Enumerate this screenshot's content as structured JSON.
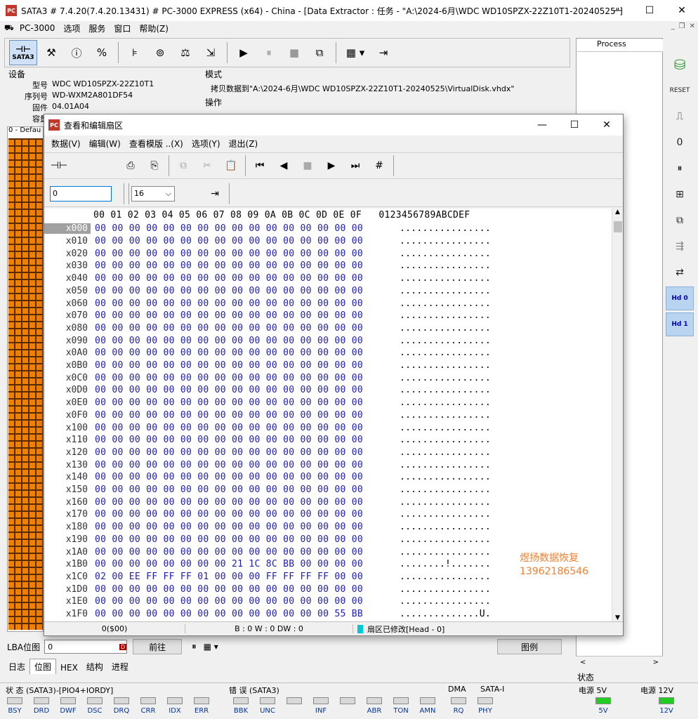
{
  "app": {
    "title": "SATA3 # 7.4.20(7.4.20.13431) # PC-3000 EXPRESS (x64) - China - [Data Extractor : 任务 - \"A:\\2024-6月\\WDC WD10SPZX-22Z10T1-20240525\"]",
    "icon_text": "PC",
    "menu": [
      "PC-3000",
      "选项",
      "服务",
      "窗口",
      "帮助(Z)"
    ],
    "toolbar": {
      "sata3_label": "SATA3"
    }
  },
  "device": {
    "section_label": "设备",
    "fields": [
      {
        "k": "型号",
        "v": "WDC WD10SPZX-22Z10T1"
      },
      {
        "k": "序列号",
        "v": "WD-WXM2A801DF54"
      },
      {
        "k": "固件",
        "v": "04.01A04"
      },
      {
        "k": "容量",
        "v": ""
      }
    ]
  },
  "mode": {
    "label": "模式",
    "text": "拷贝数据到\"A:\\2024-6月\\WDC WD10SPZX-22Z10T1-20240525\\VirtualDisk.vhdx\"",
    "op_label": "操作"
  },
  "left_tab": "0 - Defau",
  "process_label": "Process",
  "dialog": {
    "title": "查看和编辑扇区",
    "menu": [
      "数据(V)",
      "编辑(W)",
      "查看模版 ..(X)",
      "选项(Y)",
      "退出(Z)"
    ],
    "sector_value": "0",
    "size_value": "16",
    "header": "00 01 02 03 04 05 06 07 08 09 0A 0B 0C 0D 0E 0F   0123456789ABCDEF",
    "rows": [
      {
        "off": "x000",
        "bytes": "00 00 00 00 00 00 00 00 00 00 00 00 00 00 00 00",
        "ascii": "................"
      },
      {
        "off": "x010",
        "bytes": "00 00 00 00 00 00 00 00 00 00 00 00 00 00 00 00",
        "ascii": "................"
      },
      {
        "off": "x020",
        "bytes": "00 00 00 00 00 00 00 00 00 00 00 00 00 00 00 00",
        "ascii": "................"
      },
      {
        "off": "x030",
        "bytes": "00 00 00 00 00 00 00 00 00 00 00 00 00 00 00 00",
        "ascii": "................"
      },
      {
        "off": "x040",
        "bytes": "00 00 00 00 00 00 00 00 00 00 00 00 00 00 00 00",
        "ascii": "................"
      },
      {
        "off": "x050",
        "bytes": "00 00 00 00 00 00 00 00 00 00 00 00 00 00 00 00",
        "ascii": "................"
      },
      {
        "off": "x060",
        "bytes": "00 00 00 00 00 00 00 00 00 00 00 00 00 00 00 00",
        "ascii": "................"
      },
      {
        "off": "x070",
        "bytes": "00 00 00 00 00 00 00 00 00 00 00 00 00 00 00 00",
        "ascii": "................"
      },
      {
        "off": "x080",
        "bytes": "00 00 00 00 00 00 00 00 00 00 00 00 00 00 00 00",
        "ascii": "................"
      },
      {
        "off": "x090",
        "bytes": "00 00 00 00 00 00 00 00 00 00 00 00 00 00 00 00",
        "ascii": "................"
      },
      {
        "off": "x0A0",
        "bytes": "00 00 00 00 00 00 00 00 00 00 00 00 00 00 00 00",
        "ascii": "................"
      },
      {
        "off": "x0B0",
        "bytes": "00 00 00 00 00 00 00 00 00 00 00 00 00 00 00 00",
        "ascii": "................"
      },
      {
        "off": "x0C0",
        "bytes": "00 00 00 00 00 00 00 00 00 00 00 00 00 00 00 00",
        "ascii": "................"
      },
      {
        "off": "x0D0",
        "bytes": "00 00 00 00 00 00 00 00 00 00 00 00 00 00 00 00",
        "ascii": "................"
      },
      {
        "off": "x0E0",
        "bytes": "00 00 00 00 00 00 00 00 00 00 00 00 00 00 00 00",
        "ascii": "................"
      },
      {
        "off": "x0F0",
        "bytes": "00 00 00 00 00 00 00 00 00 00 00 00 00 00 00 00",
        "ascii": "................"
      },
      {
        "off": "x100",
        "bytes": "00 00 00 00 00 00 00 00 00 00 00 00 00 00 00 00",
        "ascii": "................"
      },
      {
        "off": "x110",
        "bytes": "00 00 00 00 00 00 00 00 00 00 00 00 00 00 00 00",
        "ascii": "................"
      },
      {
        "off": "x120",
        "bytes": "00 00 00 00 00 00 00 00 00 00 00 00 00 00 00 00",
        "ascii": "................"
      },
      {
        "off": "x130",
        "bytes": "00 00 00 00 00 00 00 00 00 00 00 00 00 00 00 00",
        "ascii": "................"
      },
      {
        "off": "x140",
        "bytes": "00 00 00 00 00 00 00 00 00 00 00 00 00 00 00 00",
        "ascii": "................"
      },
      {
        "off": "x150",
        "bytes": "00 00 00 00 00 00 00 00 00 00 00 00 00 00 00 00",
        "ascii": "................"
      },
      {
        "off": "x160",
        "bytes": "00 00 00 00 00 00 00 00 00 00 00 00 00 00 00 00",
        "ascii": "................"
      },
      {
        "off": "x170",
        "bytes": "00 00 00 00 00 00 00 00 00 00 00 00 00 00 00 00",
        "ascii": "................"
      },
      {
        "off": "x180",
        "bytes": "00 00 00 00 00 00 00 00 00 00 00 00 00 00 00 00",
        "ascii": "................"
      },
      {
        "off": "x190",
        "bytes": "00 00 00 00 00 00 00 00 00 00 00 00 00 00 00 00",
        "ascii": "................"
      },
      {
        "off": "x1A0",
        "bytes": "00 00 00 00 00 00 00 00 00 00 00 00 00 00 00 00",
        "ascii": "................"
      },
      {
        "off": "x1B0",
        "bytes": "00 00 00 00 00 00 00 00 21 1C 8C BB 00 00 00 00",
        "ascii": "........!......."
      },
      {
        "off": "x1C0",
        "bytes": "02 00 EE FF FF FF 01 00 00 00 FF FF FF FF 00 00",
        "ascii": "................"
      },
      {
        "off": "x1D0",
        "bytes": "00 00 00 00 00 00 00 00 00 00 00 00 00 00 00 00",
        "ascii": "................"
      },
      {
        "off": "x1E0",
        "bytes": "00 00 00 00 00 00 00 00 00 00 00 00 00 00 00 00",
        "ascii": "................"
      },
      {
        "off": "x1F0",
        "bytes": "00 00 00 00 00 00 00 00 00 00 00 00 00 00 55 BB",
        "ascii": "..............U."
      }
    ],
    "status_left": "0($00)",
    "status_mid": "B : 0 W : 0 DW : 0",
    "status_right": "扇区已修改[Head - 0]"
  },
  "watermark": {
    "line1": "煜扬数据恢复",
    "line2": "13962186546"
  },
  "lba": {
    "label": "LBA位图",
    "value": "0",
    "go": "前往",
    "legend": "图例"
  },
  "bottom_tabs": [
    "日志",
    "位图",
    "HEX",
    "结构",
    "进程"
  ],
  "status_tab": "状态",
  "status": {
    "state_label": "状 态 (SATA3)-[PIO4+IORDY]",
    "error_label": "错 误 (SATA3)",
    "dma_label": "DMA",
    "satai_label": "SATA-I",
    "p5_label": "电源 5V",
    "p12_label": "电源 12V",
    "state_leds": [
      "BSY",
      "DRD",
      "DWF",
      "DSC",
      "DRQ",
      "CRR",
      "IDX",
      "ERR"
    ],
    "error_leds": [
      "BBK",
      "UNC",
      "",
      "INF",
      "",
      "ABR",
      "TON",
      "AMN"
    ],
    "dma_led": "RQ",
    "satai_led": "PHY",
    "p5_led": "5V",
    "p12_led": "12V"
  }
}
